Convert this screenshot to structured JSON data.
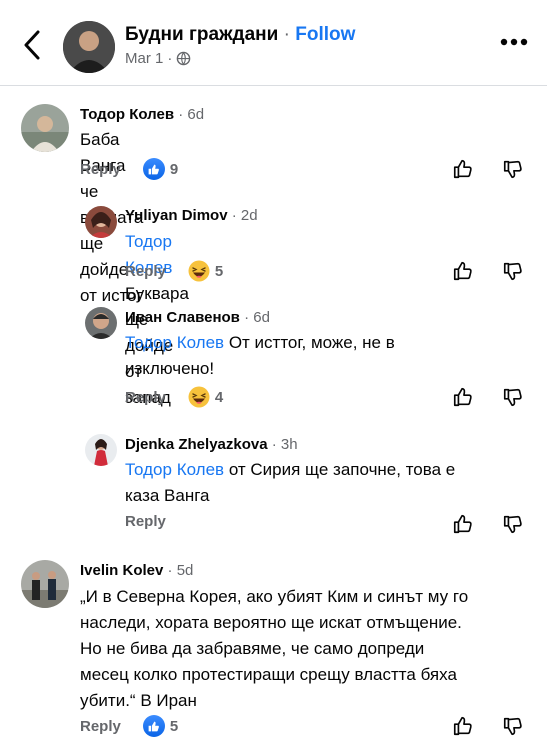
{
  "header": {
    "page_name": "Будни граждани",
    "separator": "·",
    "follow_label": "Follow",
    "date": "Mar 1",
    "sub_separator": "·",
    "privacy_icon": "globe-icon",
    "back_icon": "chevron-left-icon",
    "more_icon": "more-horizontal-icon"
  },
  "labels": {
    "reply": "Reply"
  },
  "comments": [
    {
      "author": "Тодор Колев",
      "time": "6d",
      "text": "Баба Ванга че войната ще дойде от истог",
      "reaction_icon": "like-icon",
      "reaction_count": "9"
    },
    {
      "author": "Yuliyan Dimov",
      "time": "2d",
      "mention": "Тодор Колев",
      "text": "Буквара ще дойде от запад",
      "reaction_icon": "haha-icon",
      "reaction_count": "5"
    },
    {
      "author": "Иван Славенов",
      "time": "6d",
      "mention": "Тодор Колев",
      "text": "От исттог, може, не в",
      "text2": "изключено!",
      "reaction_icon": "haha-icon",
      "reaction_count": "4"
    },
    {
      "author": "Djenka Zhelyazkova",
      "time": "3h",
      "mention": "Тодор Колев",
      "text": "от Сирия ще започне, това е",
      "text2": "каза Ванга"
    },
    {
      "author": "Ivelin Kolev",
      "time": "5d",
      "lines": [
        "„И в Северна Корея, ако убият Ким и синът му го",
        "наследи, хората вероятно ще искат отмъщение.",
        "Но не бива да забравяме, че само допреди",
        "месец колко протестиращи срещу властта бяха",
        "убити.“ В Иран"
      ],
      "reaction_icon": "like-icon",
      "reaction_count": "5"
    }
  ],
  "colors": {
    "link": "#1877f2",
    "secondary": "#65676b",
    "text": "#050505"
  }
}
